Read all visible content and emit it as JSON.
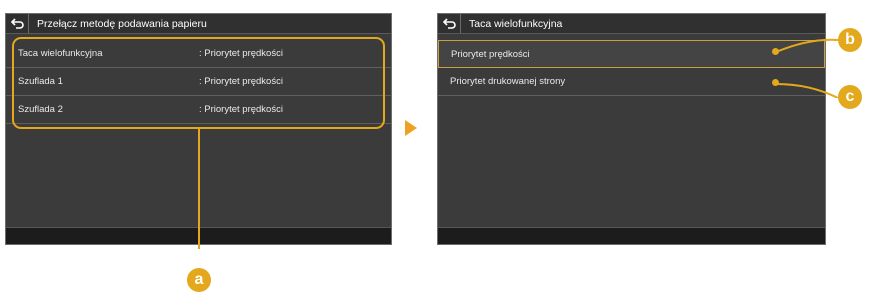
{
  "left_screen": {
    "title": "Przełącz metodę podawania papieru",
    "rows": [
      {
        "name": "Taca wielofunkcyjna",
        "value": ": Priorytet prędkości"
      },
      {
        "name": "Szuflada 1",
        "value": ": Priorytet prędkości"
      },
      {
        "name": "Szuflada 2",
        "value": ": Priorytet prędkości"
      }
    ]
  },
  "right_screen": {
    "title": "Taca wielofunkcyjna",
    "options": [
      {
        "label": "Priorytet prędkości",
        "selected": true
      },
      {
        "label": "Priorytet drukowanej strony",
        "selected": false
      }
    ]
  },
  "callouts": {
    "a": "a",
    "b": "b",
    "c": "c"
  },
  "colors": {
    "accent": "#e3a81c",
    "arrow": "#f0a020",
    "screen_bg": "#3b3b3b",
    "footer_bg": "#1c1c1c"
  },
  "icons": {
    "back": "back-arrow-icon",
    "next": "right-arrow-icon"
  }
}
